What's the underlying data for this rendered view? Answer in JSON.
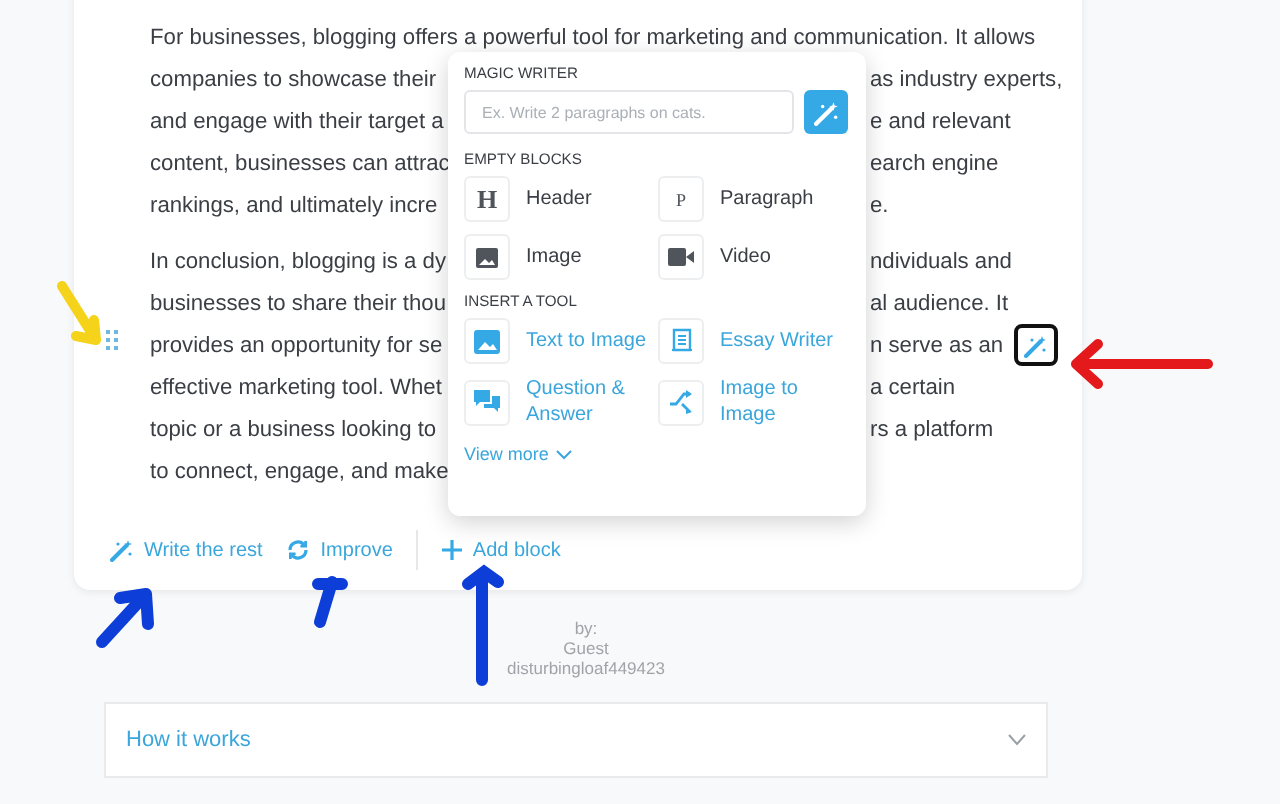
{
  "article": {
    "paragraphs": [
      {
        "lines": [
          {
            "left": "For businesses, blogging offers a powerful tool for marketing and communication. It allows"
          },
          {
            "left": "companies to showcase their",
            "right": "as industry experts,"
          },
          {
            "left": "and engage with their target a",
            "right": "e and relevant"
          },
          {
            "left": "content, businesses can attrac",
            "right": "earch engine"
          },
          {
            "left": "rankings, and ultimately incre",
            "right": "e."
          }
        ]
      },
      {
        "lines": [
          {
            "left": "In conclusion, blogging is a dy",
            "right": "ndividuals and"
          },
          {
            "left": "businesses to share their thou",
            "right": "al audience. It"
          },
          {
            "left": "provides an opportunity for se",
            "right": "n serve as an"
          },
          {
            "left": "effective marketing tool. Whet",
            "right": "a certain"
          },
          {
            "left": "topic or a business looking to",
            "right": "rs a platform"
          },
          {
            "left": "to connect, engage, and make"
          }
        ]
      }
    ],
    "actions": [
      {
        "kind": "wand",
        "label": "Write the rest"
      },
      {
        "kind": "refresh",
        "label": "Improve"
      },
      {
        "kind": "plus",
        "label": "Add block"
      }
    ]
  },
  "popup": {
    "magic_writer": {
      "heading": "MAGIC WRITER",
      "placeholder": "Ex. Write 2 paragraphs on cats."
    },
    "empty_blocks": {
      "heading": "EMPTY BLOCKS",
      "items": [
        {
          "kind": "header",
          "icon_text": "H",
          "label": "Header"
        },
        {
          "kind": "paragraph",
          "icon_text": "P",
          "label": "Paragraph"
        },
        {
          "kind": "image",
          "label": "Image"
        },
        {
          "kind": "video",
          "label": "Video"
        }
      ]
    },
    "tools": {
      "heading": "INSERT A TOOL",
      "items": [
        {
          "kind": "image",
          "label": "Text to Image"
        },
        {
          "kind": "scroll",
          "label": "Essay Writer"
        },
        {
          "kind": "qa",
          "label": "Question & Answer"
        },
        {
          "kind": "shuffle",
          "label": "Image to Image"
        }
      ]
    },
    "view_more": "View more"
  },
  "author": {
    "by": "by:",
    "name": "Guest",
    "username": "disturbingloaf449423"
  },
  "accordion": {
    "title": "How it works",
    "expanded": false
  }
}
